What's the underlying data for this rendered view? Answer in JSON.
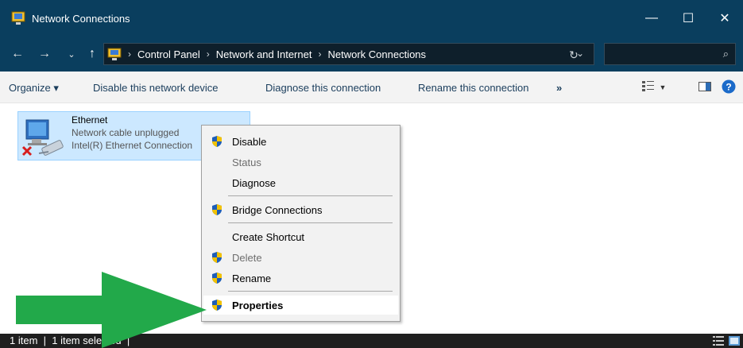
{
  "window": {
    "title": "Network Connections",
    "controls": {
      "minimize": "—",
      "maximize": "☐",
      "close": "✕"
    }
  },
  "address": {
    "breadcrumbs": [
      "Control Panel",
      "Network and Internet",
      "Network Connections"
    ],
    "search_placeholder": ""
  },
  "commands": {
    "organize": "Organize ▾",
    "disable_device": "Disable this network device",
    "diagnose": "Diagnose this connection",
    "rename": "Rename this connection",
    "more": "»"
  },
  "connection": {
    "name": "Ethernet",
    "status": "Network cable unplugged",
    "adapter": "Intel(R) Ethernet Connection"
  },
  "context_menu": {
    "items": [
      {
        "label": "Disable",
        "shield": true,
        "disabled": false
      },
      {
        "label": "Status",
        "shield": false,
        "disabled": true
      },
      {
        "label": "Diagnose",
        "shield": false,
        "disabled": false
      },
      {
        "label": "Bridge Connections",
        "shield": true,
        "disabled": false
      },
      {
        "label": "Create Shortcut",
        "shield": false,
        "disabled": false
      },
      {
        "label": "Delete",
        "shield": true,
        "disabled": true
      },
      {
        "label": "Rename",
        "shield": true,
        "disabled": false
      },
      {
        "label": "Properties",
        "shield": true,
        "disabled": false
      }
    ]
  },
  "status_bar": {
    "text": "1 item  |  1 item selected  |"
  },
  "colors": {
    "titlebar": "#0a3e5e",
    "selection": "#cce8ff",
    "arrow": "#22a94a",
    "shield_blue": "#1e5eb8",
    "shield_gold": "#f2c200"
  }
}
